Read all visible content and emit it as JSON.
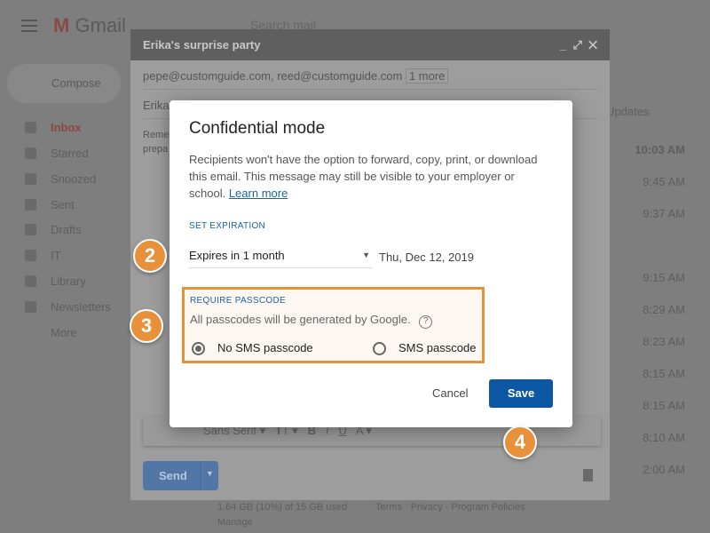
{
  "gmail": {
    "logo": "Gmail",
    "search_placeholder": "Search mail",
    "compose": "Compose",
    "nav": [
      "Inbox",
      "Starred",
      "Snoozed",
      "Sent",
      "Drafts",
      "IT",
      "Library",
      "Newsletters",
      "More"
    ],
    "tab": "Updates",
    "times": [
      "10:03 AM",
      "9:45 AM",
      "9:37 AM",
      "9:15 AM",
      "8:29 AM",
      "8:23 AM",
      "8:15 AM",
      "8:15 AM",
      "8:10 AM",
      "2:00 AM"
    ],
    "storage": "1.64 GB (10%) of 15 GB used",
    "manage": "Manage",
    "footer_links": "Terms · Privacy · Program Policies"
  },
  "compose": {
    "title": "Erika's surprise party",
    "recipients": "pepe@customguide.com, reed@customguide.com",
    "more": "1 more",
    "subject": "Erika's",
    "body": [
      "Reme",
      "prepa"
    ],
    "font": "Sans Serif",
    "send": "Send"
  },
  "dialog": {
    "title": "Confidential mode",
    "description": "Recipients won't have the option to forward, copy, print, or download this email. This message may still be visible to your employer or school.",
    "learn_more": "Learn more",
    "set_expiration": "SET EXPIRATION",
    "expiry_option": "Expires in 1 month",
    "expiry_date": "Thu, Dec 12, 2019",
    "require_passcode": "REQUIRE PASSCODE",
    "passcode_info": "All passcodes will be generated by Google.",
    "no_sms": "No SMS passcode",
    "sms": "SMS passcode",
    "selected": "No SMS passcode",
    "cancel": "Cancel",
    "save": "Save"
  },
  "callouts": [
    "2",
    "3",
    "4"
  ],
  "colors": {
    "accent": "#1a63a8",
    "save": "#0b57a4",
    "callout": "#e8903a"
  }
}
